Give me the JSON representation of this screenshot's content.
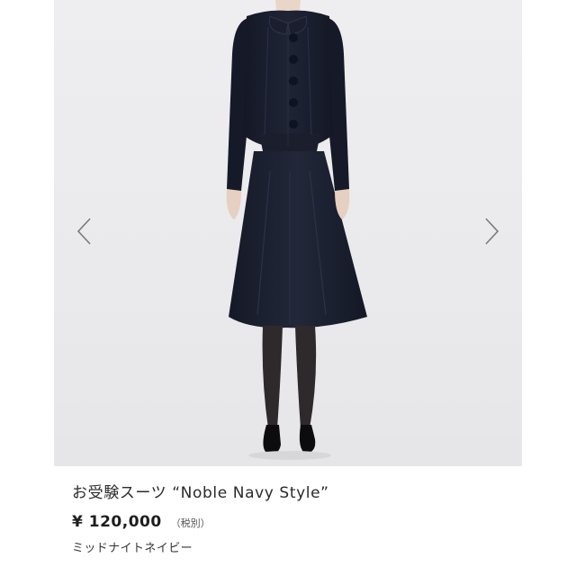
{
  "gallery": {
    "prev_icon": "chevron-left-icon",
    "next_icon": "chevron-right-icon",
    "arrow_color": "#7a7a7a",
    "background_color": "#ececee"
  },
  "product": {
    "title": "お受験スーツ “Noble Navy Style”",
    "price": "¥ 120,000",
    "tax_note": "（税別）",
    "color_name": "ミッドナイトネイビー",
    "suit_color": "#1b1f2e"
  }
}
